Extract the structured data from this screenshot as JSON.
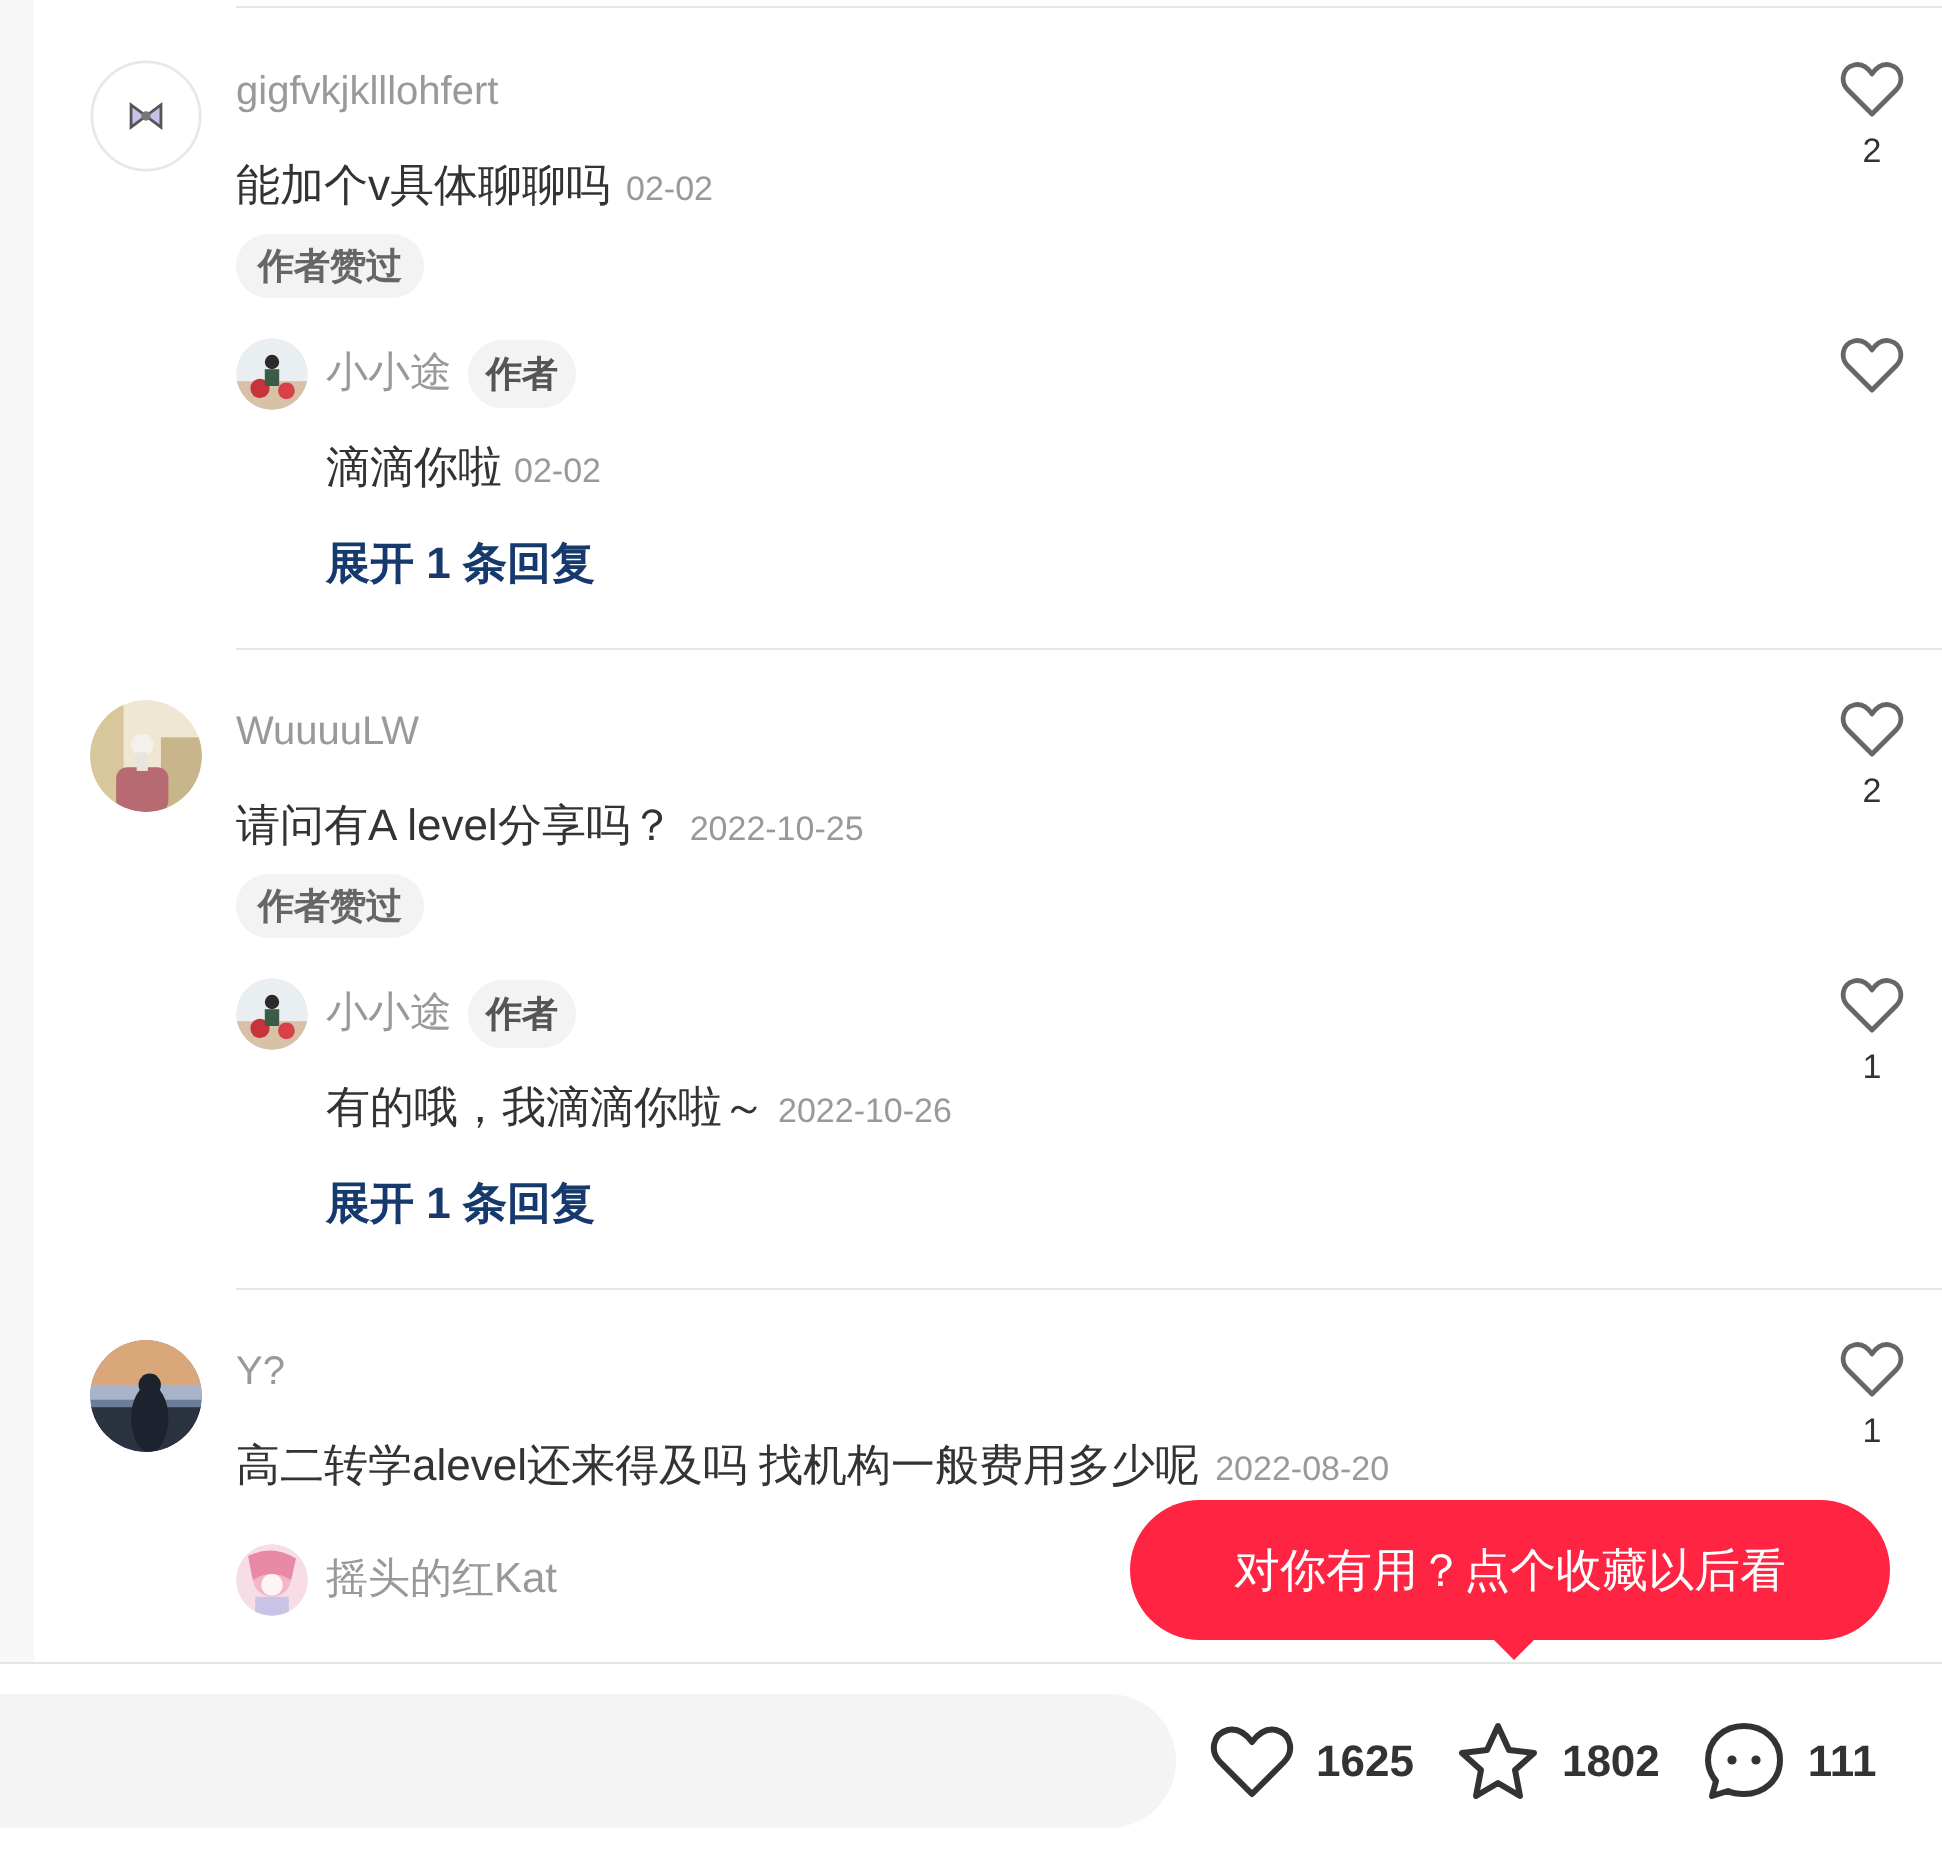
{
  "comments": [
    {
      "user": "gigfvkjklllohfert",
      "text": "能加个v具体聊聊吗",
      "date": "02-02",
      "tag": "作者赞过",
      "likes": "2",
      "replies": [
        {
          "user": "小小途",
          "badge": "作者",
          "text": "滴滴你啦",
          "date": "02-02"
        }
      ],
      "expand": "展开 1 条回复"
    },
    {
      "user": "WuuuuLW",
      "text": "请问有A level分享吗？",
      "date": "2022-10-25",
      "tag": "作者赞过",
      "likes": "2",
      "replies": [
        {
          "user": "小小途",
          "badge": "作者",
          "text": "有的哦，我滴滴你啦～",
          "date": "2022-10-26",
          "likes": "1"
        }
      ],
      "expand": "展开 1 条回复"
    },
    {
      "user": "Y?",
      "text": "高二转学alevel还来得及吗 找机构一般费用多少呢",
      "date": "2022-08-20",
      "likes": "1",
      "replies": [
        {
          "user": "摇头的红Kat"
        }
      ]
    }
  ],
  "tooltip": "对你有用？点个收藏以后看",
  "bottom_bar": {
    "likes": "1625",
    "collects": "1802",
    "comments": "111"
  }
}
